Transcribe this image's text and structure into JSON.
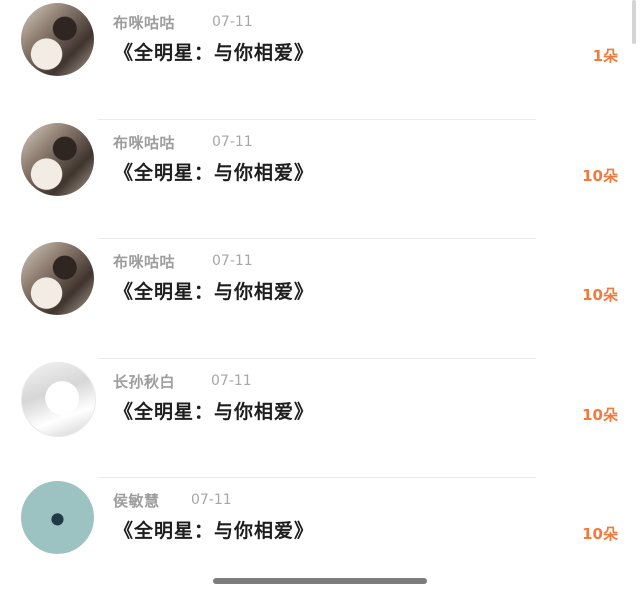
{
  "items": [
    {
      "user": "布咪咕咕",
      "date": "07-11",
      "title": "《全明星：与你相爱》",
      "count": "1朵",
      "avatar_icon": "user-photo"
    },
    {
      "user": "布咪咕咕",
      "date": "07-11",
      "title": "《全明星：与你相爱》",
      "count": "10朵",
      "avatar_icon": "user-photo"
    },
    {
      "user": "布咪咕咕",
      "date": "07-11",
      "title": "《全明星：与你相爱》",
      "count": "10朵",
      "avatar_icon": "user-photo"
    },
    {
      "user": "长孙秋白",
      "date": "07-11",
      "title": "《全明星：与你相爱》",
      "count": "10朵",
      "avatar_icon": "sketch-portrait"
    },
    {
      "user": "侯敏慧",
      "date": "07-11",
      "title": "《全明星：与你相爱》",
      "count": "10朵",
      "avatar_icon": "whale-icon"
    }
  ],
  "colors": {
    "accent": "#f27a3c",
    "name_gray": "#9d9d9d",
    "title": "#1e1e1e",
    "teal_avatar": "#9cc2c1"
  }
}
